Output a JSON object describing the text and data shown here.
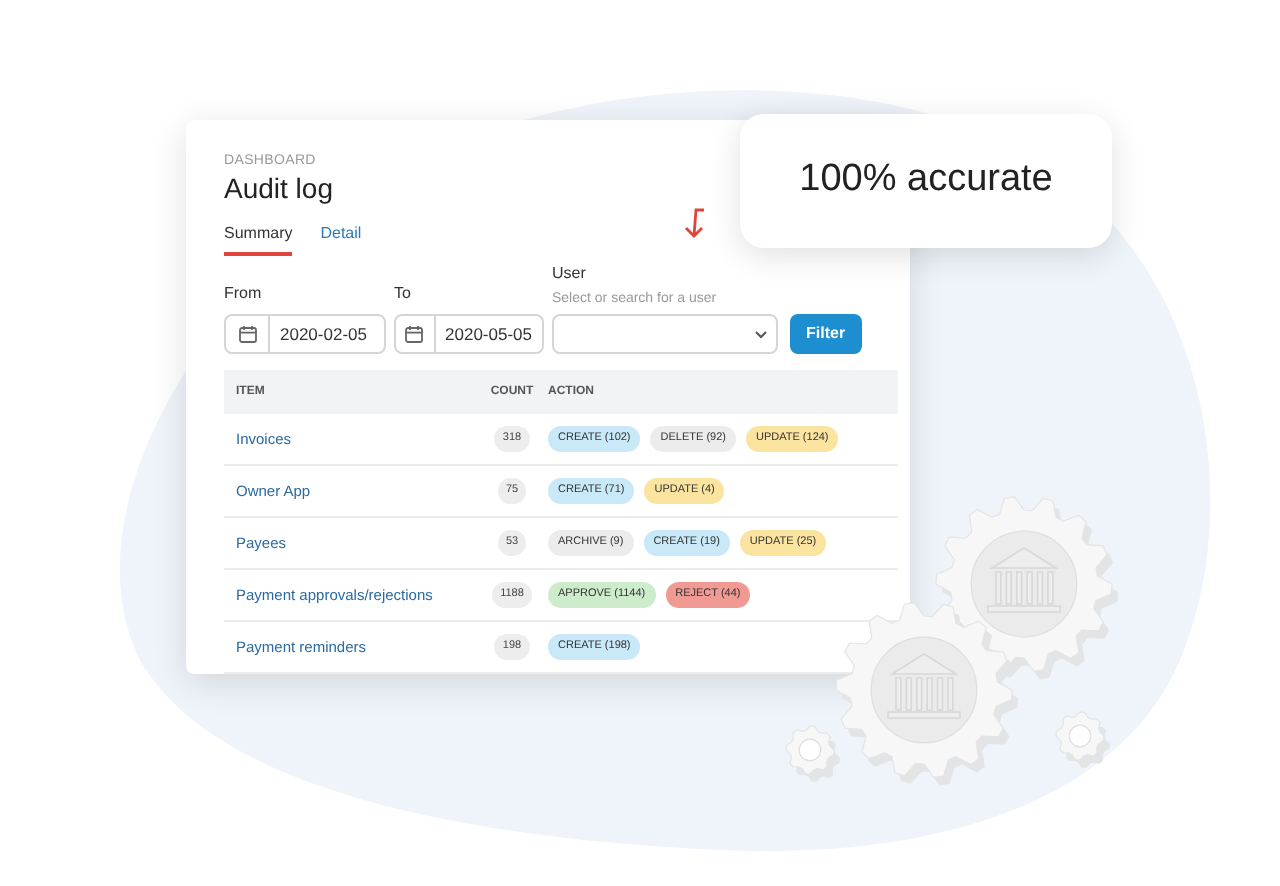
{
  "breadcrumb": "DASHBOARD",
  "title": "Audit log",
  "tabs": [
    {
      "label": "Summary",
      "selected": true
    },
    {
      "label": "Detail",
      "selected": false
    }
  ],
  "filters": {
    "from": {
      "label": "From",
      "value": "2020-02-05"
    },
    "to": {
      "label": "To",
      "value": "2020-05-05"
    },
    "user": {
      "label": "User",
      "hint": "Select or search for a user"
    },
    "button": "Filter"
  },
  "table": {
    "columns": [
      "ITEM",
      "COUNT",
      "ACTION"
    ],
    "rows": [
      {
        "item": "Invoices",
        "count": "318",
        "actions": [
          {
            "label": "CREATE (102)",
            "color": "#c9e8f8"
          },
          {
            "label": "DELETE (92)",
            "color": "#ececec"
          },
          {
            "label": "UPDATE (124)",
            "color": "#fbe3a0"
          }
        ]
      },
      {
        "item": "Owner App",
        "count": "75",
        "actions": [
          {
            "label": "CREATE (71)",
            "color": "#c9e8f8"
          },
          {
            "label": "UPDATE (4)",
            "color": "#fbe3a0"
          }
        ]
      },
      {
        "item": "Payees",
        "count": "53",
        "actions": [
          {
            "label": "ARCHIVE (9)",
            "color": "#ececec"
          },
          {
            "label": "CREATE (19)",
            "color": "#c9e8f8"
          },
          {
            "label": "UPDATE (25)",
            "color": "#fbe3a0"
          }
        ]
      },
      {
        "item": "Payment approvals/rejections",
        "count": "1188",
        "actions": [
          {
            "label": "APPROVE (1144)",
            "color": "#cdeccb"
          },
          {
            "label": "REJECT (44)",
            "color": "#f19a93"
          }
        ]
      },
      {
        "item": "Payment reminders",
        "count": "198",
        "actions": [
          {
            "label": "CREATE (198)",
            "color": "#c9e8f8"
          }
        ]
      }
    ]
  },
  "callout": "100% accurate"
}
